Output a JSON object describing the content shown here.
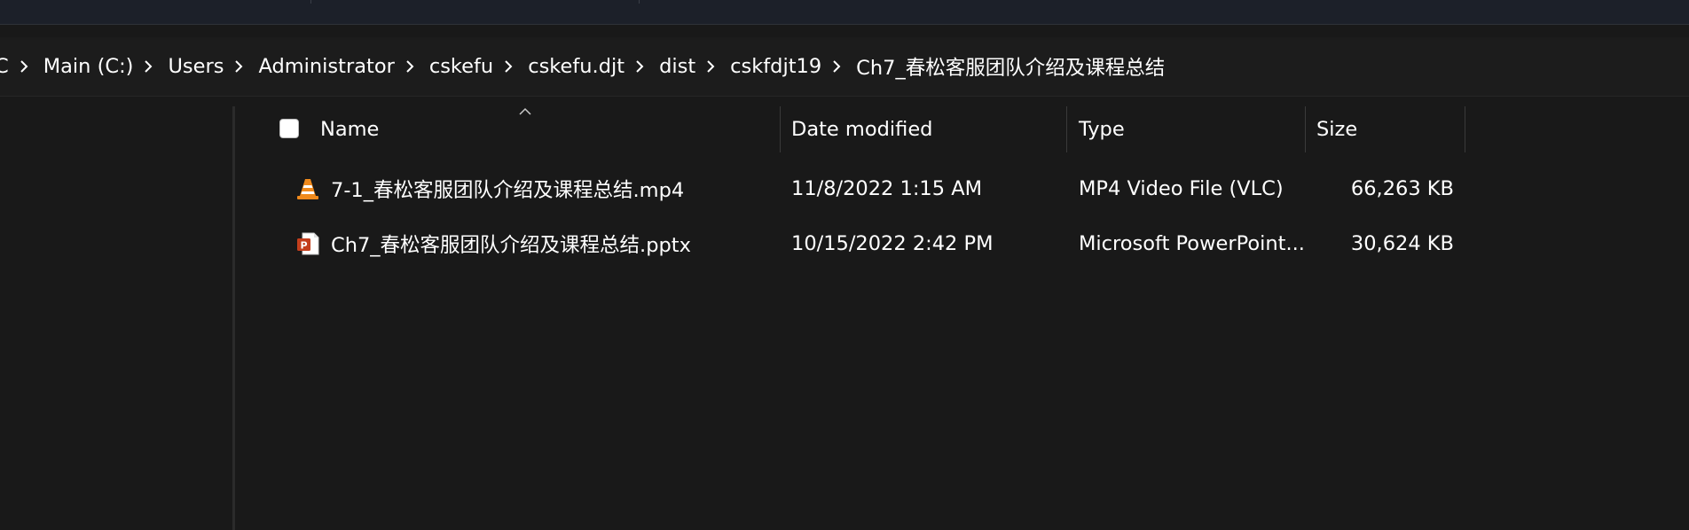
{
  "breadcrumb": [
    "C",
    "Main (C:)",
    "Users",
    "Administrator",
    "cskefu",
    "cskefu.djt",
    "dist",
    "cskfdjt19",
    "Ch7_春松客服团队介绍及课程总结"
  ],
  "columns": {
    "name": "Name",
    "date_modified": "Date modified",
    "type": "Type",
    "size": "Size"
  },
  "files": [
    {
      "name": "7-1_春松客服团队介绍及课程总结.mp4",
      "date_modified": "11/8/2022 1:15 AM",
      "type": "MP4 Video File (VLC)",
      "size": "66,263 KB",
      "icon": "vlc-cone-icon"
    },
    {
      "name": "Ch7_春松客服团队介绍及课程总结.pptx",
      "date_modified": "10/15/2022 2:42 PM",
      "type": "Microsoft PowerPoint...",
      "size": "30,624 KB",
      "icon": "powerpoint-file-icon"
    }
  ],
  "colors": {
    "background": "#191919",
    "text": "#ffffff",
    "vlc_orange": "#f08a1c",
    "powerpoint_red": "#c43e1c"
  }
}
